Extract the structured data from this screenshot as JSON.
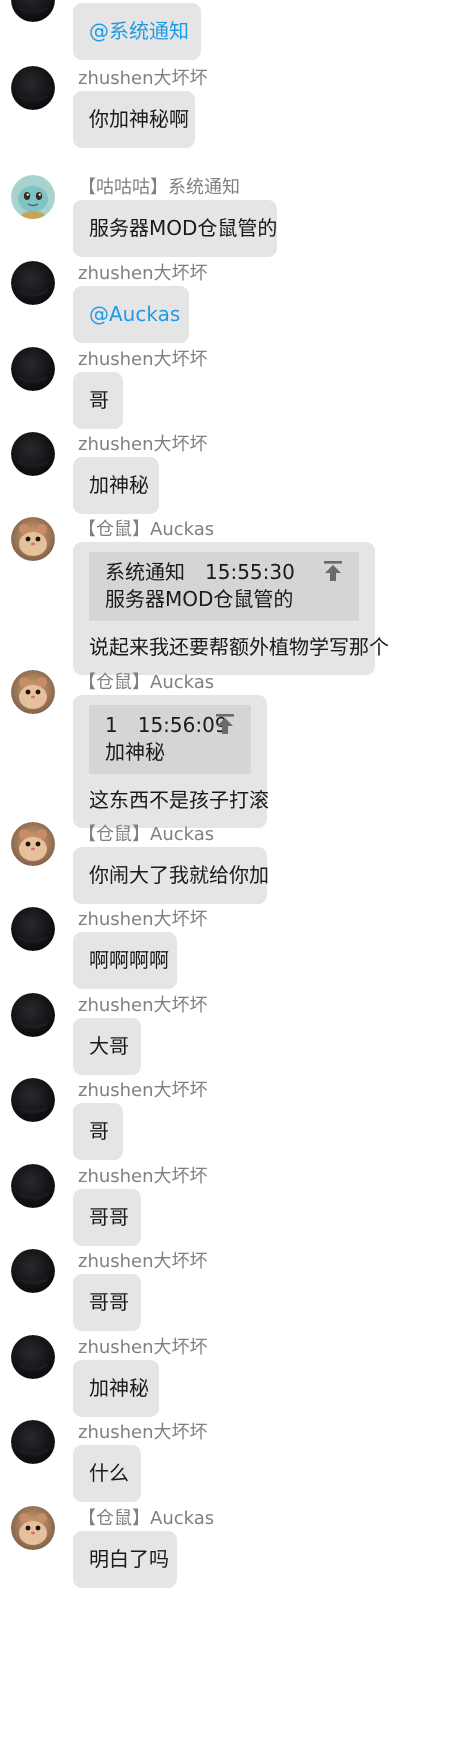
{
  "messages": [
    {
      "id": "m1",
      "sender": "",
      "avatar": "dark",
      "text": "@系统通知",
      "mention": true
    },
    {
      "id": "m2",
      "sender": "zhushen大坏坏",
      "avatar": "dark",
      "text": "你加神秘啊"
    },
    {
      "id": "m3",
      "sender": "【咕咕咕】系统通知",
      "avatar": "squirtle",
      "text": "服务器MOD仓鼠管的"
    },
    {
      "id": "m4",
      "sender": "zhushen大坏坏",
      "avatar": "dark",
      "text": "@Auckas",
      "mention": true
    },
    {
      "id": "m5",
      "sender": "zhushen大坏坏",
      "avatar": "dark",
      "text": "哥"
    },
    {
      "id": "m6",
      "sender": "zhushen大坏坏",
      "avatar": "dark",
      "text": "加神秘"
    },
    {
      "id": "m7",
      "sender": "【仓鼠】Auckas",
      "avatar": "hamster",
      "quote": {
        "from": "系统通知",
        "time": "15:55:30",
        "text": "服务器MOD仓鼠管的"
      },
      "text": "说起来我还要帮额外植物学写那个"
    },
    {
      "id": "m8",
      "sender": "【仓鼠】Auckas",
      "avatar": "hamster",
      "quote": {
        "from": "1",
        "time": "15:56:09",
        "text": "加神秘"
      },
      "text": "这东西不是孩子打滚"
    },
    {
      "id": "m9",
      "sender": "【仓鼠】Auckas",
      "avatar": "hamster",
      "text": "你闹大了我就给你加"
    },
    {
      "id": "m10",
      "sender": "zhushen大坏坏",
      "avatar": "dark",
      "text": "啊啊啊啊"
    },
    {
      "id": "m11",
      "sender": "zhushen大坏坏",
      "avatar": "dark",
      "text": "大哥"
    },
    {
      "id": "m12",
      "sender": "zhushen大坏坏",
      "avatar": "dark",
      "text": "哥"
    },
    {
      "id": "m13",
      "sender": "zhushen大坏坏",
      "avatar": "dark",
      "text": "哥哥"
    },
    {
      "id": "m14",
      "sender": "zhushen大坏坏",
      "avatar": "dark",
      "text": "哥哥"
    },
    {
      "id": "m15",
      "sender": "zhushen大坏坏",
      "avatar": "dark",
      "text": "加神秘"
    },
    {
      "id": "m16",
      "sender": "zhushen大坏坏",
      "avatar": "dark",
      "text": "什么"
    },
    {
      "id": "m17",
      "sender": "【仓鼠】Auckas",
      "avatar": "hamster",
      "text": "明白了吗"
    }
  ],
  "colors": {
    "mention": "#1e9be6",
    "bubble": "#e5e5e5",
    "quote": "#d5d5d5",
    "name": "#808080"
  }
}
